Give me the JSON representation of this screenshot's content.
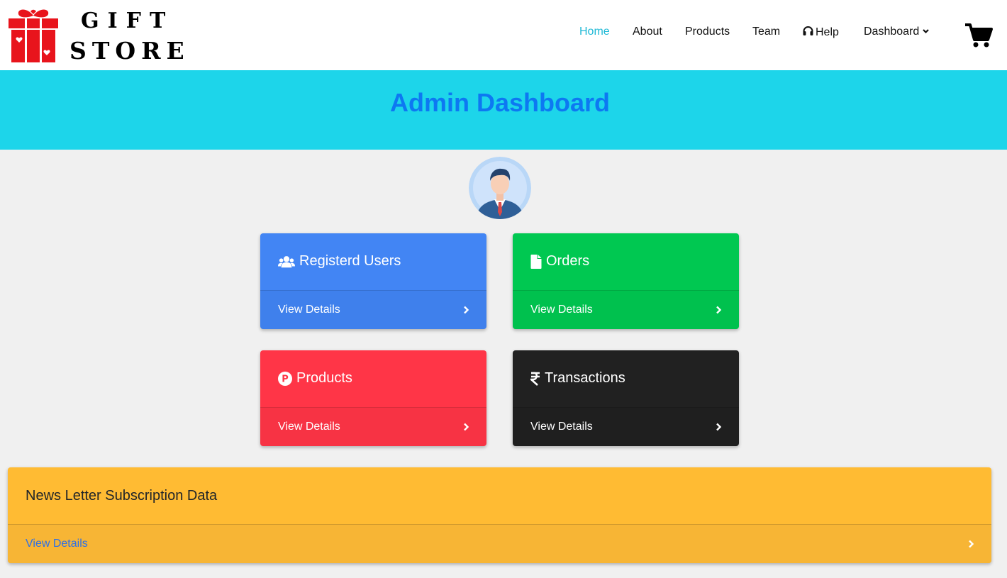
{
  "brand": {
    "line1": "GIFT",
    "line2": "STORE"
  },
  "nav": {
    "home": "Home",
    "about": "About",
    "products": "Products",
    "team": "Team",
    "help": "Help",
    "dashboard": "Dashboard"
  },
  "colors": {
    "active_nav": "#1fb9d6",
    "banner": "#1dd5ea",
    "banner_title": "#0d78f2",
    "users": "#4285f4",
    "orders": "#00c851",
    "products": "#ff3547",
    "transactions": "#212121",
    "newsletter": "#ffbb33"
  },
  "banner": {
    "title": "Admin Dashboard"
  },
  "cards": [
    {
      "title": "Registerd Users",
      "icon": "users-icon",
      "link": "View Details"
    },
    {
      "title": "Orders",
      "icon": "file-icon",
      "link": "View Details"
    },
    {
      "title": "Products",
      "icon": "product-p-icon",
      "link": "View Details"
    },
    {
      "title": "Transactions",
      "icon": "rupee-icon",
      "link": "View Details"
    }
  ],
  "newsletter": {
    "title": "News Letter Subscription Data",
    "link": "View Details"
  }
}
